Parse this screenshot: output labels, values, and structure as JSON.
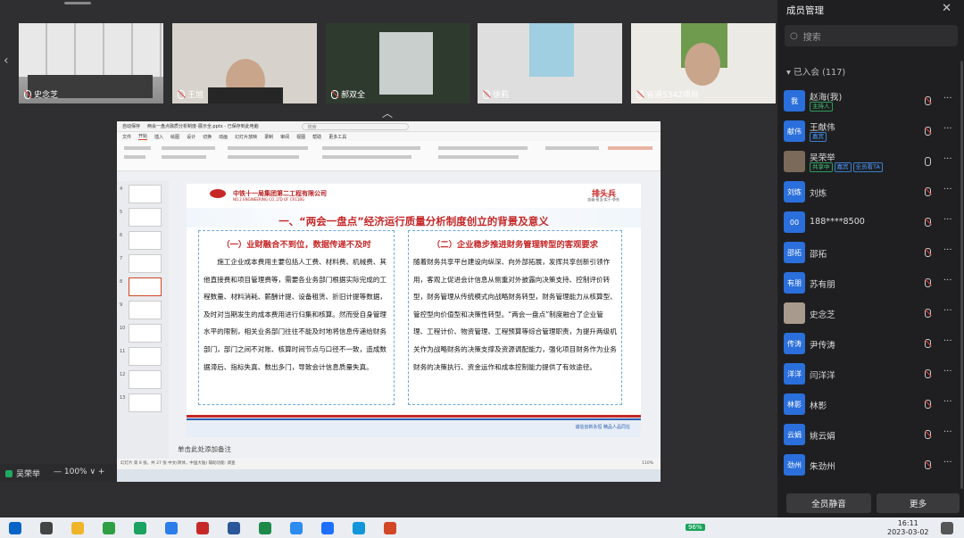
{
  "video_strip": {
    "participants": [
      {
        "name": "史念芝"
      },
      {
        "name": "王旭"
      },
      {
        "name": "郝双全"
      },
      {
        "name": "徐莉"
      },
      {
        "name": "省道S342项目"
      }
    ]
  },
  "ppt": {
    "window_title": "两会一盘点融质分析制度-展示全.pptx - 已保存到此电脑",
    "autosave": "自动保存",
    "search_placeholder": "搜索",
    "menu": [
      "文件",
      "开始",
      "插入",
      "绘图",
      "设计",
      "切换",
      "动画",
      "幻灯片放映",
      "录制",
      "审阅",
      "视图",
      "帮助",
      "更多工具"
    ],
    "active_menu": "开始",
    "slide_numbers": [
      "4",
      "5",
      "6",
      "7",
      "8",
      "9",
      "10",
      "11",
      "12",
      "13"
    ],
    "selected_slide": "8",
    "slide": {
      "company_cn": "中铁十一局集团第二工程有限公司",
      "company_en": "NO.2 ENGINEERING CO.,LTD OF CR11BG",
      "logo_text": "中国铁建",
      "brand": "排头兵",
      "brand_sub": "忠诚·担当·实干·争先",
      "title": "一、“两会一盘点”经济运行质量分析制度创立的背景及意义",
      "left_heading": "（一）业财融合不到位，数据传递不及时",
      "left_body": "施工企业成本费用主要包括人工费、材料费、机械费、其他直接费和项目管理费等，需要各业务部门根据实际完成的工程数量、材料消耗、薪酬计提、设备租赁、折旧计提等数据，及时对当期发生的成本费用进行归集和核算。然而受自身管理水平的限制，相关业务部门往往不能及时地将信息传递给财务部门，部门之间不对账、核算时间节点与口径不一致，造成数据滞后、指标失真、数出多门，导致会计信息质量失真。",
      "right_heading": "（二）企业稳步推进财务管理转型的客观要求",
      "right_body": "随着财务共享平台建设向纵深、向外部拓展，发挥共享创新引领作用，客观上促进会计信息从侧重对外披露向决策支持、控制评价转型，财务管理从传统模式向战略财务转型，财务管理能力从核算型、管控型向价值型和决策性转型。“两会一盘点”制度融合了企业管理、工程计价、物资管理、工程预算等综合管理职责，为提升两级机关作为战略财务的决策支撑及资源调配能力，强化项目财务作为业务财务的决策执行、资金运作和成本控制能力提供了有效途径。",
      "footer": "诚信创新永恒   精品人品同在"
    },
    "notes_placeholder": "单击此处添加备注",
    "status": "幻灯片 第 8 张，共 27 张   中文(简体，中国大陆)   辅助功能: 调查",
    "zoom": "110%"
  },
  "zoom_bar": {
    "user": "吴荣举",
    "zoom": "100%"
  },
  "members": {
    "title": "成员管理",
    "search_placeholder": "搜索",
    "group_label": "已入会 (117)",
    "list": [
      {
        "avatar": "我",
        "name": "赵海(我)",
        "tags": [
          "主持人"
        ],
        "tag_color": "g",
        "mic": "off"
      },
      {
        "avatar": "献伟",
        "name": "王献伟",
        "tags": [
          "嘉宾"
        ],
        "tag_color": "b",
        "mic": "off"
      },
      {
        "avatar": "",
        "name": "吴荣举",
        "tags": [
          "共享中",
          "嘉宾",
          "全员看TA"
        ],
        "tag_color": "mix",
        "mic": "on"
      },
      {
        "avatar": "刘炼",
        "name": "刘炼",
        "tags": [],
        "mic": "off"
      },
      {
        "avatar": "00",
        "name": "188****8500",
        "tags": [],
        "mic": "off"
      },
      {
        "avatar": "邵拓",
        "name": "邵拓",
        "tags": [],
        "mic": "off"
      },
      {
        "avatar": "有朋",
        "name": "苏有朋",
        "tags": [],
        "mic": "off"
      },
      {
        "avatar": "",
        "name": "史念芝",
        "tags": [],
        "mic": "off"
      },
      {
        "avatar": "传涛",
        "name": "尹传涛",
        "tags": [],
        "mic": "off"
      },
      {
        "avatar": "洋洋",
        "name": "闫洋洋",
        "tags": [],
        "mic": "off"
      },
      {
        "avatar": "林影",
        "name": "林影",
        "tags": [],
        "mic": "off"
      },
      {
        "avatar": "云娟",
        "name": "姚云娟",
        "tags": [],
        "mic": "off"
      },
      {
        "avatar": "劲州",
        "name": "朱劲州",
        "tags": [],
        "mic": "off"
      }
    ],
    "mute_all": "全员静音",
    "more": "更多"
  },
  "taskbar": {
    "battery": "96%",
    "time": "16:11",
    "date": "2023-03-02"
  }
}
